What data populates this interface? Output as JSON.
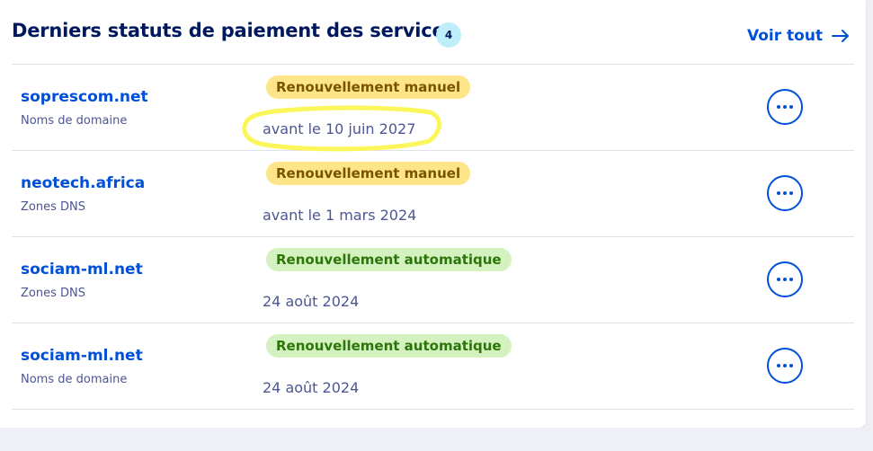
{
  "header": {
    "title": "Derniers statuts de paiement des services",
    "count": "4",
    "see_all_label": "Voir tout"
  },
  "rows": [
    {
      "name": "soprescom.net",
      "type": "Noms de domaine",
      "status": "Renouvellement manuel",
      "date": "avant le 10 juin 2027",
      "highlighted": true
    },
    {
      "name": "neotech.africa",
      "type": "Zones DNS",
      "status": "Renouvellement manuel",
      "date": "avant le 1 mars 2024"
    },
    {
      "name": "sociam-ml.net",
      "type": "Zones DNS",
      "status": "Renouvellement automatique",
      "date": "24 août 2024"
    },
    {
      "name": "sociam-ml.net",
      "type": "Noms de domaine",
      "status": "Renouvellement automatique",
      "date": "24 août 2024"
    }
  ],
  "colors": {
    "accent": "#0050d7",
    "title": "#00185e",
    "badge_manual_bg": "#ffe58a",
    "badge_manual_text": "#795400",
    "badge_auto_bg": "#d4f2bf",
    "badge_auto_text": "#2b7509",
    "highlight_marker": "#fbf65a"
  },
  "icons": {
    "see_all": "arrow-right-icon",
    "row_action": "more-options-icon"
  }
}
